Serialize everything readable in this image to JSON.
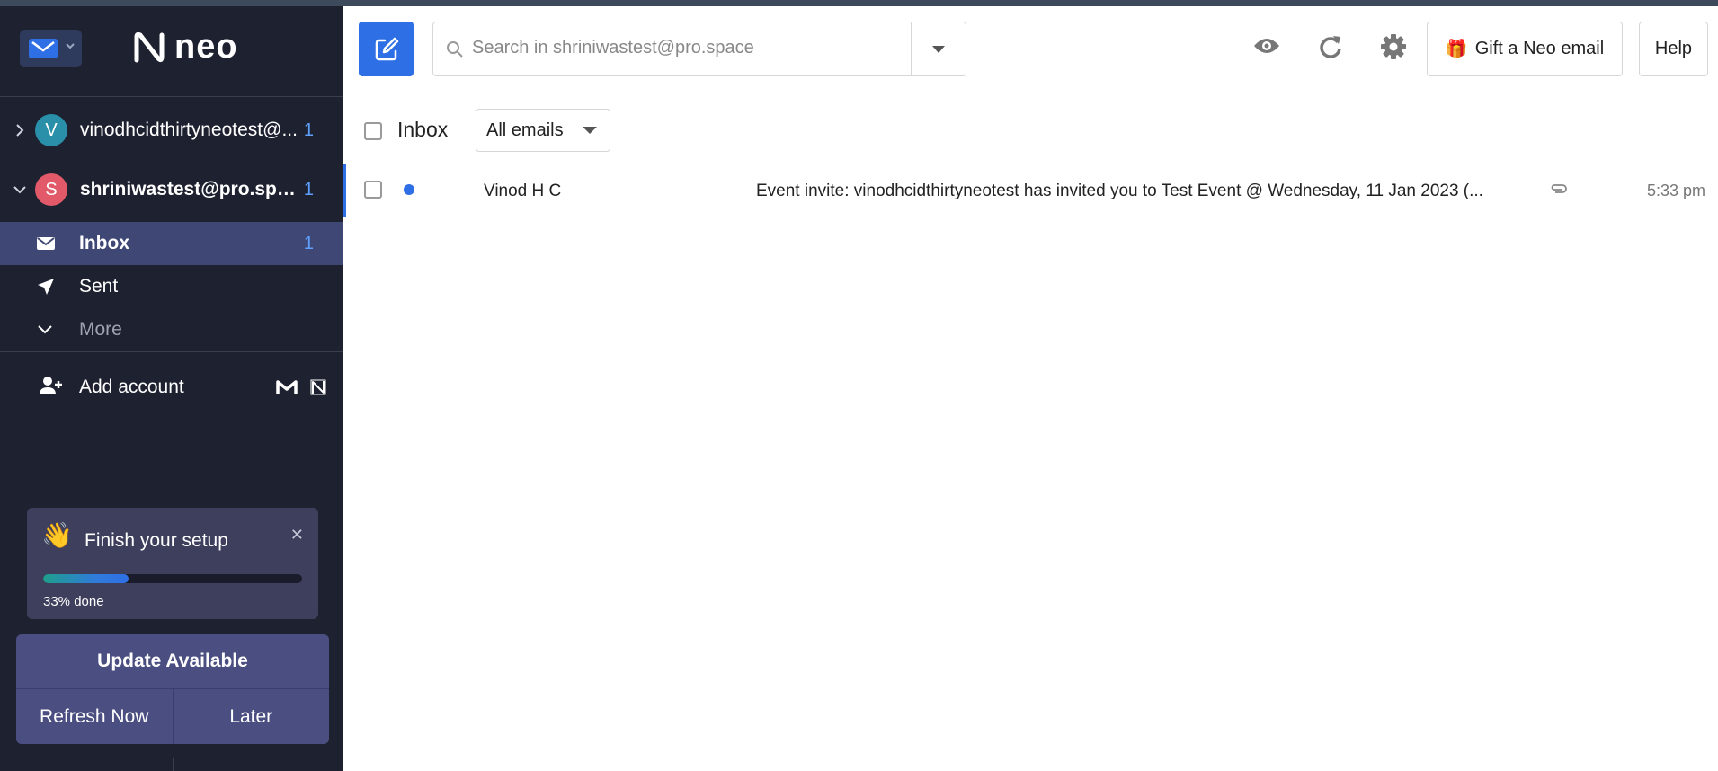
{
  "app": {
    "logo_text": "neo",
    "brand_color": "#2f6fe6"
  },
  "sidebar": {
    "accounts": [
      {
        "initial": "V",
        "name": "vinodhcidthirtyneotest@...",
        "count": "1",
        "color": "#2a8fa8",
        "expanded": false
      },
      {
        "initial": "S",
        "name": "shriniwastest@pro.space",
        "count": "1",
        "color": "#e25a6a",
        "expanded": true
      }
    ],
    "folders": [
      {
        "label": "Inbox",
        "count": "1",
        "icon": "envelope-icon",
        "active": true
      },
      {
        "label": "Sent",
        "count": "",
        "icon": "paper-plane-icon",
        "active": false
      },
      {
        "label": "More",
        "count": "",
        "icon": "chevron-down-icon",
        "active": false
      }
    ],
    "add_account_label": "Add account",
    "setup": {
      "title": "Finish your setup",
      "progress_text": "33% done",
      "progress": 0.33
    },
    "update": {
      "title": "Update Available",
      "refresh_label": "Refresh Now",
      "later_label": "Later"
    }
  },
  "toolbar": {
    "search_placeholder": "Search in shriniwastest@pro.space",
    "gift_label": "Gift a Neo email",
    "help_label": "Help"
  },
  "list": {
    "title": "Inbox",
    "filter_label": "All emails",
    "emails": [
      {
        "from": "Vinod H C",
        "subject": "Event invite: vinodhcidthirtyneotest has invited you to Test Event @ Wednesday, 11 Jan 2023 (...",
        "time": "5:33 pm",
        "unread": true,
        "has_attachment": true
      }
    ]
  }
}
